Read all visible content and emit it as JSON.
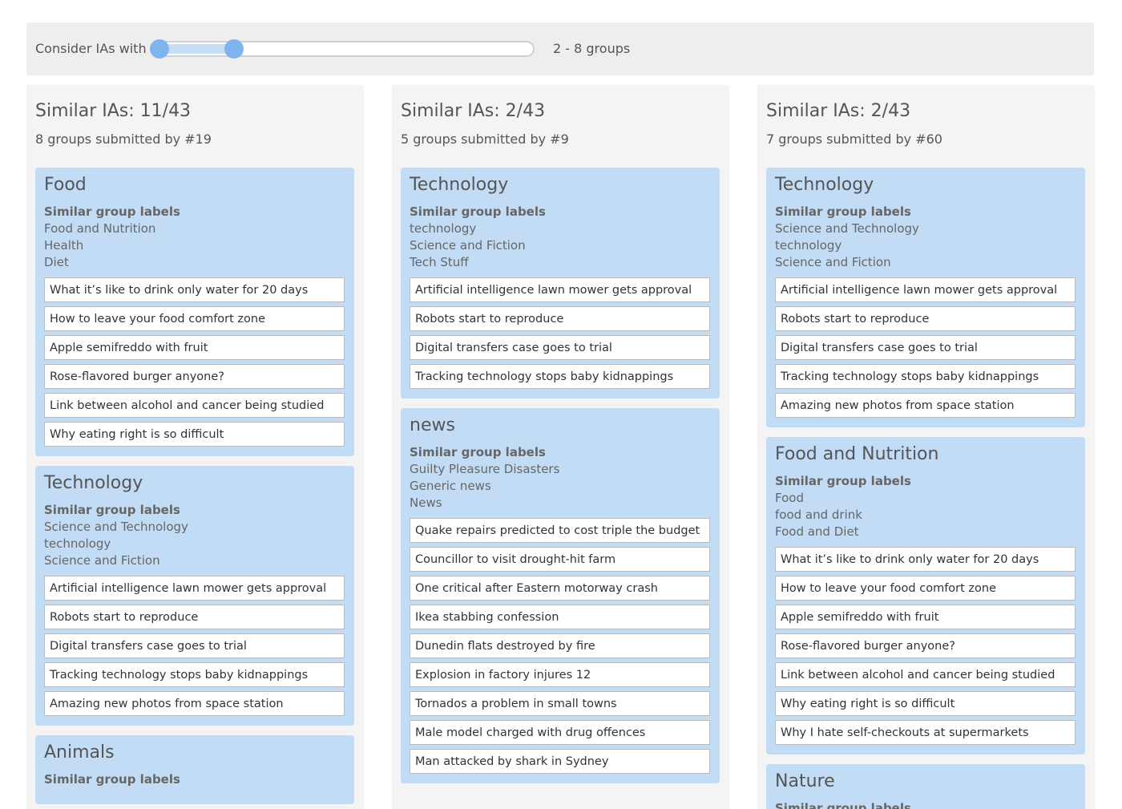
{
  "filter": {
    "label": "Consider IAs with",
    "value_text": "2 - 8 groups",
    "min": 2,
    "max": 8,
    "range_min": 1,
    "range_max": 22
  },
  "columns": [
    {
      "title": "Similar IAs: 11/43",
      "subtitle": "8 groups submitted by #19",
      "groups": [
        {
          "title": "Food",
          "similar_heading": "Similar group labels",
          "similar_labels": [
            "Food and Nutrition",
            "Health",
            "Diet"
          ],
          "items": [
            "What it’s like to drink only water for 20 days",
            "How to leave your food comfort zone",
            "Apple semifreddo with fruit",
            "Rose-flavored burger anyone?",
            "Link between alcohol and cancer being studied",
            "Why eating right is so difficult"
          ]
        },
        {
          "title": "Technology",
          "similar_heading": "Similar group labels",
          "similar_labels": [
            "Science and Technology",
            "technology",
            "Science and Fiction"
          ],
          "items": [
            "Artificial intelligence lawn mower gets approval",
            "Robots start to reproduce",
            "Digital transfers case goes to trial",
            "Tracking technology stops baby kidnappings",
            "Amazing new photos from space station"
          ]
        },
        {
          "title": "Animals",
          "similar_heading": "Similar group labels",
          "similar_labels": [],
          "items": []
        }
      ]
    },
    {
      "title": "Similar IAs: 2/43",
      "subtitle": "5 groups submitted by #9",
      "groups": [
        {
          "title": "Technology",
          "similar_heading": "Similar group labels",
          "similar_labels": [
            "technology",
            "Science and Fiction",
            "Tech Stuff"
          ],
          "items": [
            "Artificial intelligence lawn mower gets approval",
            "Robots start to reproduce",
            "Digital transfers case goes to trial",
            "Tracking technology stops baby kidnappings"
          ]
        },
        {
          "title": "news",
          "similar_heading": "Similar group labels",
          "similar_labels": [
            "Guilty Pleasure Disasters",
            "Generic news",
            "News"
          ],
          "items": [
            "Quake repairs predicted to cost triple the budget",
            "Councillor to visit drought-hit farm",
            "One critical after Eastern motorway crash",
            "Ikea stabbing confession",
            "Dunedin flats destroyed by fire",
            "Explosion in factory injures 12",
            "Tornados a problem in small towns",
            "Male model charged with drug offences",
            "Man attacked by shark in Sydney"
          ]
        }
      ]
    },
    {
      "title": "Similar IAs: 2/43",
      "subtitle": "7 groups submitted by #60",
      "groups": [
        {
          "title": "Technology",
          "similar_heading": "Similar group labels",
          "similar_labels": [
            "Science and Technology",
            "technology",
            "Science and Fiction"
          ],
          "items": [
            "Artificial intelligence lawn mower gets approval",
            "Robots start to reproduce",
            "Digital transfers case goes to trial",
            "Tracking technology stops baby kidnappings",
            "Amazing new photos from space station"
          ]
        },
        {
          "title": "Food and Nutrition",
          "similar_heading": "Similar group labels",
          "similar_labels": [
            "Food",
            "food and drink",
            "Food and Diet"
          ],
          "items": [
            "What it’s like to drink only water for 20 days",
            "How to leave your food comfort zone",
            "Apple semifreddo with fruit",
            "Rose-flavored burger anyone?",
            "Link between alcohol and cancer being studied",
            "Why eating right is so difficult",
            "Why I hate self-checkouts at supermarkets"
          ]
        },
        {
          "title": "Nature",
          "similar_heading": "Similar group labels",
          "similar_labels": [],
          "items": []
        }
      ]
    }
  ]
}
